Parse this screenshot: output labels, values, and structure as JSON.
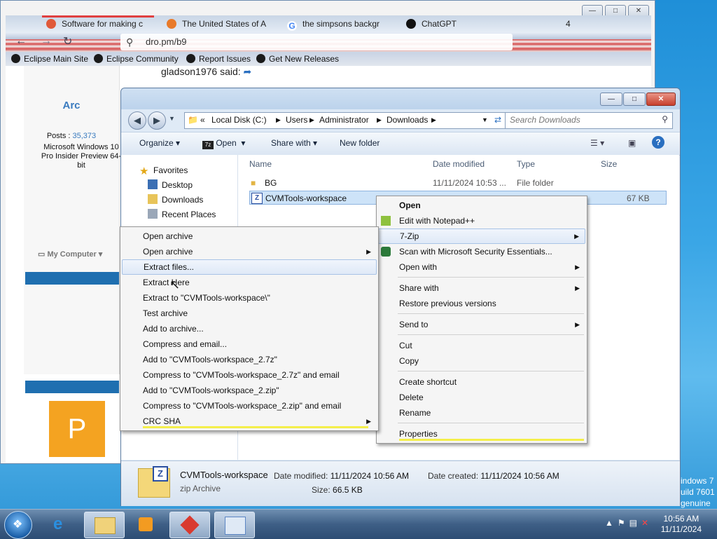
{
  "browser": {
    "tabs": [
      {
        "label": "Software for making c",
        "color": "#e05a3a"
      },
      {
        "label": "The United States of A",
        "color": "#e87a2a"
      },
      {
        "label": "the simpsons backgr",
        "color": "#4285f4"
      },
      {
        "label": "ChatGPT",
        "color": "#111111"
      }
    ],
    "tab_count": "4",
    "url": "dro.pm/b9",
    "bookmarks": [
      "Eclipse Main Site",
      "Eclipse Community",
      "Report Issues",
      "Get New Releases"
    ],
    "forum": {
      "quote_author": "gladson1976 said:",
      "username": "Arc",
      "posts_label": "Posts :",
      "posts_value": "35,373",
      "os": "Microsoft Windows 10 Pro Insider Preview 64-bit",
      "my_computer": "My Computer",
      "avatar_letter": "P"
    }
  },
  "explorer": {
    "breadcrumb": [
      "Local Disk (C:)",
      "Users",
      "Administrator",
      "Downloads"
    ],
    "search_placeholder": "Search Downloads",
    "toolbar": {
      "organize": "Organize",
      "open": "Open",
      "share_with": "Share with",
      "new_folder": "New folder"
    },
    "nav": {
      "favorites": "Favorites",
      "desktop": "Desktop",
      "downloads": "Downloads",
      "recent": "Recent Places"
    },
    "columns": {
      "name": "Name",
      "date": "Date modified",
      "type": "Type",
      "size": "Size"
    },
    "files": [
      {
        "name": "BG",
        "date": "11/11/2024 10:53 ...",
        "type": "File folder",
        "size": ""
      },
      {
        "name": "CVMTools-workspace",
        "date": "",
        "type": "",
        "size": "67 KB"
      }
    ],
    "details": {
      "name": "CVMTools-workspace",
      "type": "zip Archive",
      "date_modified_label": "Date modified:",
      "date_modified": "11/11/2024 10:56 AM",
      "size_label": "Size:",
      "size": "66.5 KB",
      "date_created_label": "Date created:",
      "date_created": "11/11/2024 10:56 AM"
    }
  },
  "context_menu": [
    "Open",
    "Edit with Notepad++",
    "7-Zip",
    "Scan with Microsoft Security Essentials...",
    "Open with",
    "Share with",
    "Restore previous versions",
    "Send to",
    "Cut",
    "Copy",
    "Create shortcut",
    "Delete",
    "Rename",
    "Properties"
  ],
  "zip_menu": [
    "Open archive",
    "Open archive",
    "Extract files...",
    "Extract Here",
    "Extract to \"CVMTools-workspace\\\"",
    "Test archive",
    "Add to archive...",
    "Compress and email...",
    "Add to \"CVMTools-workspace_2.7z\"",
    "Compress to \"CVMTools-workspace_2.7z\" and email",
    "Add to \"CVMTools-workspace_2.zip\"",
    "Compress to \"CVMTools-workspace_2.zip\" and email",
    "CRC SHA"
  ],
  "taskbar": {
    "time": "10:56 AM",
    "date": "11/11/2024"
  },
  "desktop_text": [
    "indows 7",
    "uild 7601",
    "genuine"
  ]
}
